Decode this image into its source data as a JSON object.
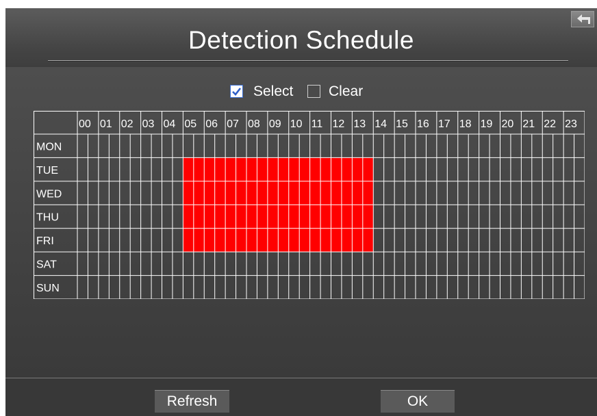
{
  "header": {
    "title": "Detection Schedule",
    "back_icon": "back-arrow-icon"
  },
  "toggle": {
    "select_label": "Select",
    "select_checked": true,
    "clear_label": "Clear",
    "clear_checked": false
  },
  "schedule": {
    "hours": [
      "00",
      "01",
      "02",
      "03",
      "04",
      "05",
      "06",
      "07",
      "08",
      "09",
      "10",
      "11",
      "12",
      "13",
      "14",
      "15",
      "16",
      "17",
      "18",
      "19",
      "20",
      "21",
      "22",
      "23"
    ],
    "days": [
      "MON",
      "TUE",
      "WED",
      "THU",
      "FRI",
      "SAT",
      "SUN"
    ],
    "half_hour_slots_per_hour": 2,
    "selected_color": "#ff0000",
    "selected_ranges": [
      {
        "day": "TUE",
        "from": "05:00",
        "to": "14:00"
      },
      {
        "day": "WED",
        "from": "05:00",
        "to": "14:00"
      },
      {
        "day": "THU",
        "from": "05:00",
        "to": "14:00"
      },
      {
        "day": "FRI",
        "from": "05:00",
        "to": "14:00"
      }
    ]
  },
  "footer": {
    "refresh_label": "Refresh",
    "ok_label": "OK"
  }
}
